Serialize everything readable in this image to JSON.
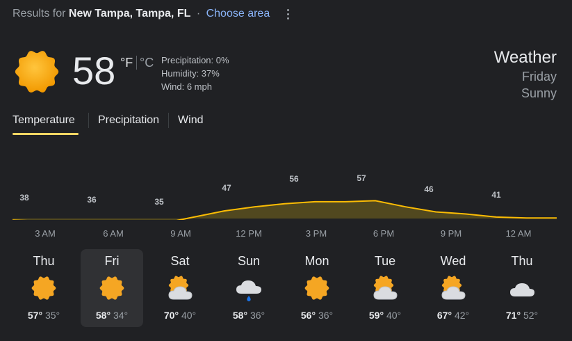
{
  "header": {
    "results_prefix": "Results for",
    "location": "New Tampa, Tampa, FL",
    "separator": "·",
    "choose_area": "Choose area"
  },
  "current": {
    "temp": "58",
    "unit_f": "°F",
    "unit_c": "°C",
    "precipitation": "Precipitation: 0%",
    "humidity": "Humidity: 37%",
    "wind": "Wind: 6 mph",
    "icon": "sun-icon"
  },
  "title": {
    "heading": "Weather",
    "day": "Friday",
    "condition": "Sunny"
  },
  "tabs": [
    {
      "label": "Temperature",
      "active": true
    },
    {
      "label": "Precipitation",
      "active": false
    },
    {
      "label": "Wind",
      "active": false
    }
  ],
  "chart_data": {
    "type": "area",
    "x": [
      "3 AM",
      "6 AM",
      "9 AM",
      "12 PM",
      "3 PM",
      "6 PM",
      "9 PM",
      "12 AM"
    ],
    "labels": [
      38,
      36,
      35,
      47,
      56,
      57,
      46,
      41
    ],
    "series": [
      {
        "values": [
          38,
          37,
          36,
          36,
          35,
          35,
          41,
          47,
          51,
          54,
          56,
          56,
          57,
          51,
          46,
          44,
          41,
          40,
          40
        ]
      }
    ],
    "colors": {
      "line": "#fbbc04",
      "fill": "#5b4f1e"
    }
  },
  "forecast": [
    {
      "day": "Thu",
      "hi": "57°",
      "lo": "35°",
      "icon": "sun-icon"
    },
    {
      "day": "Fri",
      "hi": "58°",
      "lo": "34°",
      "icon": "sun-icon",
      "selected": true
    },
    {
      "day": "Sat",
      "hi": "70°",
      "lo": "40°",
      "icon": "partly-cloudy-icon"
    },
    {
      "day": "Sun",
      "hi": "58°",
      "lo": "36°",
      "icon": "rain-cloud-icon"
    },
    {
      "day": "Mon",
      "hi": "56°",
      "lo": "36°",
      "icon": "sun-icon"
    },
    {
      "day": "Tue",
      "hi": "59°",
      "lo": "40°",
      "icon": "partly-cloudy-icon"
    },
    {
      "day": "Wed",
      "hi": "67°",
      "lo": "42°",
      "icon": "partly-cloudy-icon"
    },
    {
      "day": "Thu",
      "hi": "71°",
      "lo": "52°",
      "icon": "cloud-icon"
    }
  ],
  "colors": {
    "background": "#202124",
    "accent": "#fdd663",
    "link": "#8ab4f8"
  }
}
